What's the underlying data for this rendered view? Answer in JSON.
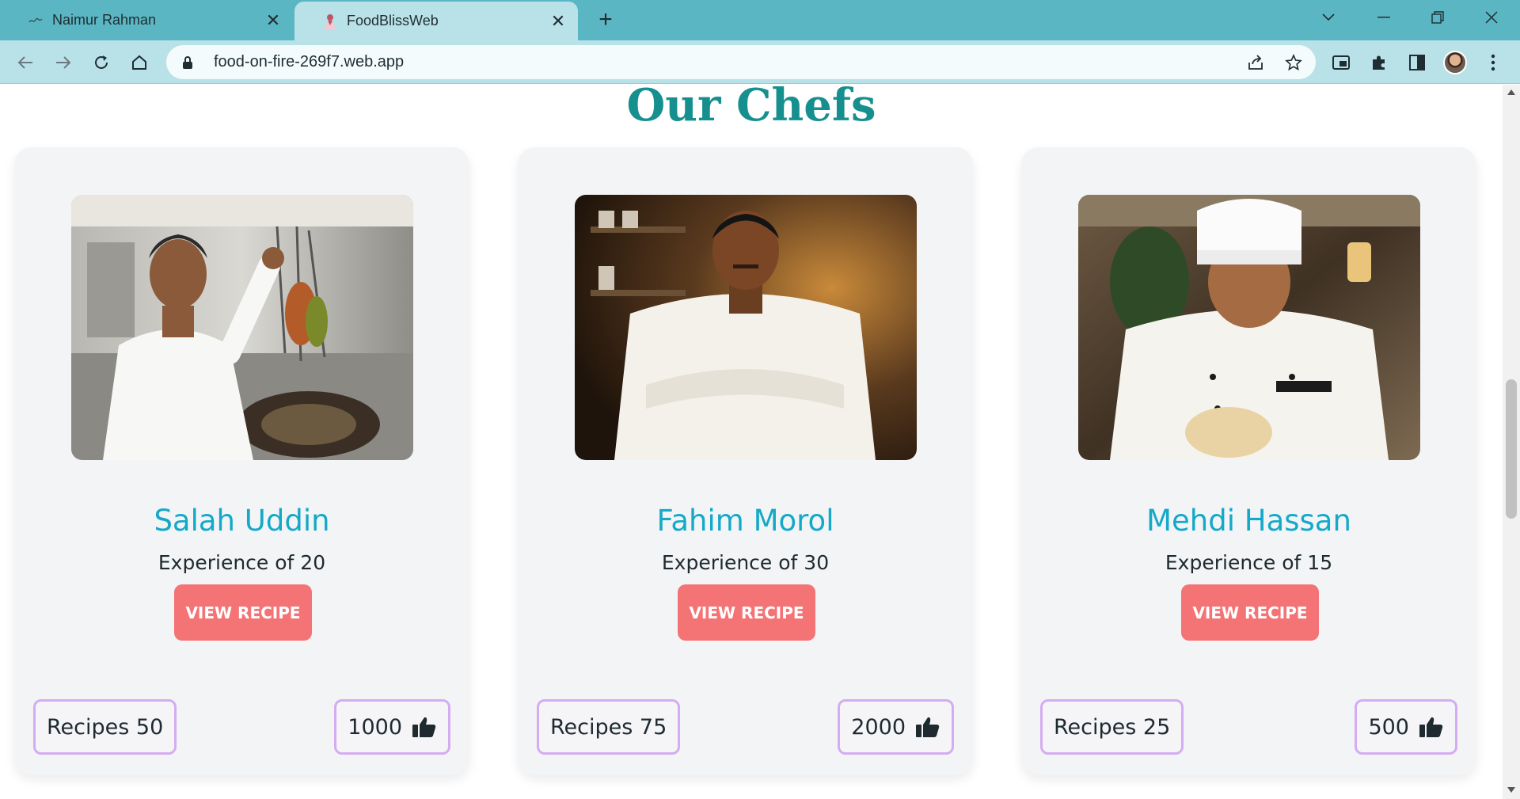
{
  "browser": {
    "tabs": [
      {
        "title": "Naimur Rahman",
        "active": false
      },
      {
        "title": "FoodBlissWeb",
        "active": true
      }
    ],
    "url": "food-on-fire-269f7.web.app"
  },
  "page": {
    "section_title": "Our Chefs",
    "chefs": [
      {
        "name": "Salah Uddin",
        "experience": "Experience of 20",
        "button": "VIEW RECIPE",
        "recipes": "Recipes 50",
        "likes": "1000"
      },
      {
        "name": "Fahim Morol",
        "experience": "Experience of 30",
        "button": "VIEW RECIPE",
        "recipes": "Recipes 75",
        "likes": "2000"
      },
      {
        "name": "Mehdi Hassan",
        "experience": "Experience of 15",
        "button": "VIEW RECIPE",
        "recipes": "Recipes 25",
        "likes": "500"
      }
    ]
  },
  "colors": {
    "title": "#16908f",
    "chef_name": "#14a9c9",
    "button": "#f47475",
    "badge_border": "#d3acf1",
    "tabbar": "#5bb6c3",
    "toolbar": "#b9e2e8"
  },
  "icons": {
    "likes": "thumbs-up-icon",
    "lock": "lock-icon"
  }
}
